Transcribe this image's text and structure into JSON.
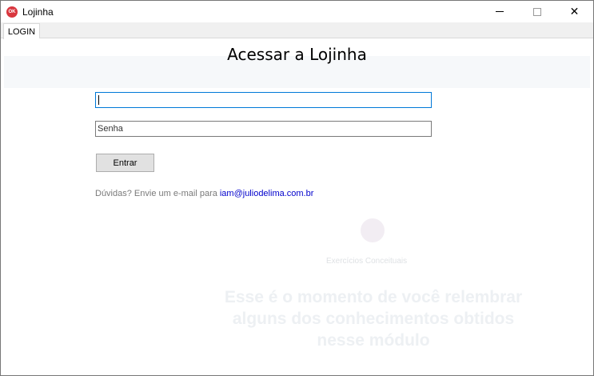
{
  "background": {
    "faded_text": "eituais"
  },
  "window": {
    "title": "Lojinha",
    "icon_text": "OK",
    "controls": {
      "minimize": "minimize",
      "maximize": "maximize",
      "close": "✕"
    }
  },
  "tabs": [
    {
      "label": "LOGIN",
      "active": true
    }
  ],
  "login": {
    "heading": "Acessar a Lojinha",
    "username": {
      "value": "",
      "placeholder": ""
    },
    "password": {
      "value": "",
      "placeholder": "Senha"
    },
    "submit_label": "Entrar",
    "help_text": "Dúvidas? Envie um e-mail para",
    "help_email": "iam@juliodelima.com.br"
  },
  "ghost_content": {
    "caption": "Exercícios Conceituais",
    "message": "Esse é o momento de você relembrar alguns dos conhecimentos obtidos nesse módulo"
  },
  "colors": {
    "accent": "#0078d7",
    "link": "#0000cc",
    "app_icon": "#d9363e"
  }
}
